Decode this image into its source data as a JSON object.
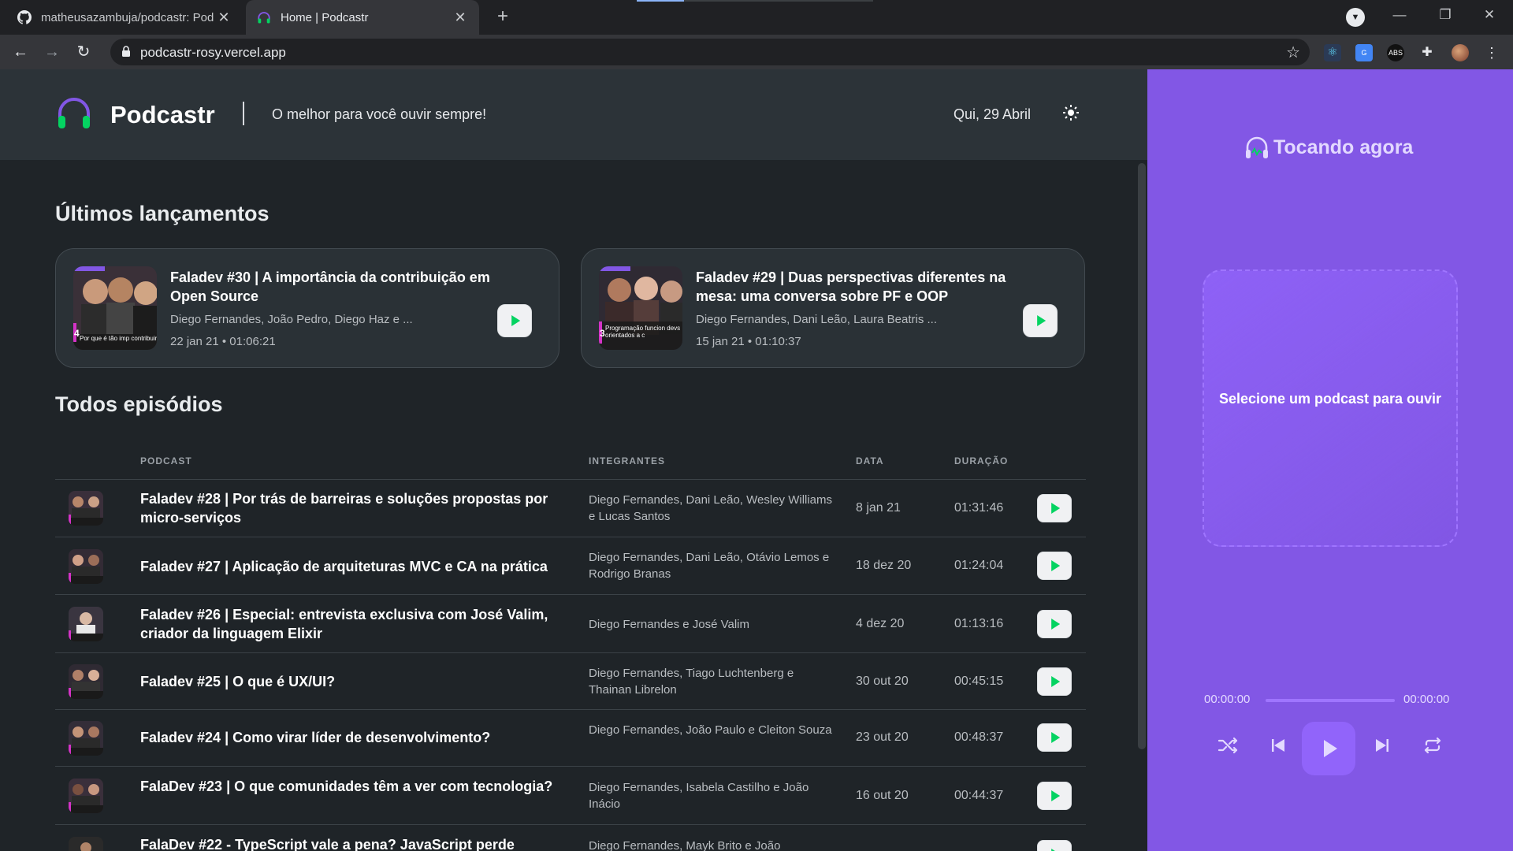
{
  "browser": {
    "tabs": [
      {
        "title": "matheusazambuja/podcastr: Pod",
        "icon": "github-icon"
      },
      {
        "title": "Home | Podcastr",
        "icon": "headphone-icon"
      }
    ],
    "url": "podcastr-rosy.vercel.app",
    "extension_label": "ABS"
  },
  "header": {
    "logo_text": "Podcastr",
    "tagline": "O melhor para você ouvir sempre!",
    "date": "Qui, 29 Abril"
  },
  "latest": {
    "title": "Últimos lançamentos",
    "episodes": [
      {
        "title": "Faladev #30 | A importância da contribuição em Open Source",
        "members": "Diego Fernandes, João Pedro, Diego Haz e ...",
        "meta": "22 jan 21 • 01:06:21",
        "thumb_caption": "Por que é tão imp contribuir em Open S",
        "thumb_number": "4"
      },
      {
        "title": "Faladev #29 | Duas perspectivas diferentes na mesa: uma conversa sobre PF e OOP",
        "members": "Diego Fernandes, Dani Leão, Laura Beatris ...",
        "meta": "15 jan 21 • 01:10:37",
        "thumb_caption": "Programação funcion devs orientados a c",
        "thumb_number": "3"
      }
    ]
  },
  "all": {
    "title": "Todos episódios",
    "columns": {
      "podcast": "PODCAST",
      "members": "INTEGRANTES",
      "date": "DATA",
      "duration": "DURAÇÃO"
    },
    "rows": [
      {
        "title": "Faladev #28 | Por trás de barreiras e soluções propostas por micro-serviços",
        "members": "Diego Fernandes, Dani Leão, Wesley Williams e Lucas Santos",
        "date": "8 jan 21",
        "duration": "01:31:46"
      },
      {
        "title": "Faladev #27 | Aplicação de arquiteturas MVC e CA na prática",
        "members": "Diego Fernandes, Dani Leão, Otávio Lemos e Rodrigo Branas",
        "date": "18 dez 20",
        "duration": "01:24:04"
      },
      {
        "title": "Faladev #26 | Especial: entrevista exclusiva com José Valim, criador da linguagem Elixir",
        "members": "Diego Fernandes e José Valim",
        "date": "4 dez 20",
        "duration": "01:13:16"
      },
      {
        "title": "Faladev #25 | O que é UX/UI?",
        "members": "Diego Fernandes, Tiago Luchtenberg e Thainan Librelon",
        "date": "30 out 20",
        "duration": "00:45:15"
      },
      {
        "title": "Faladev #24 | Como virar líder de desenvolvimento?",
        "members": "Diego Fernandes, João Paulo e Cleiton Souza",
        "date": "23 out 20",
        "duration": "00:48:37"
      },
      {
        "title": "FalaDev #23 | O que comunidades têm a ver com tecnologia?",
        "members": "Diego Fernandes, Isabela Castilho e João Inácio",
        "date": "16 out 20",
        "duration": "00:44:37"
      },
      {
        "title": "FalaDev #22 - TypeScript vale a pena? JavaScript perde",
        "members": "Diego Fernandes, Mayk Brito e João",
        "date": "",
        "duration": ""
      }
    ]
  },
  "player": {
    "header": "Tocando agora",
    "empty_text": "Selecione um podcast para ouvir",
    "current_time": "00:00:00",
    "total_time": "00:00:00"
  },
  "colors": {
    "accent_green": "#04d361",
    "player_purple": "#8257e5",
    "background": "#1f2428"
  }
}
